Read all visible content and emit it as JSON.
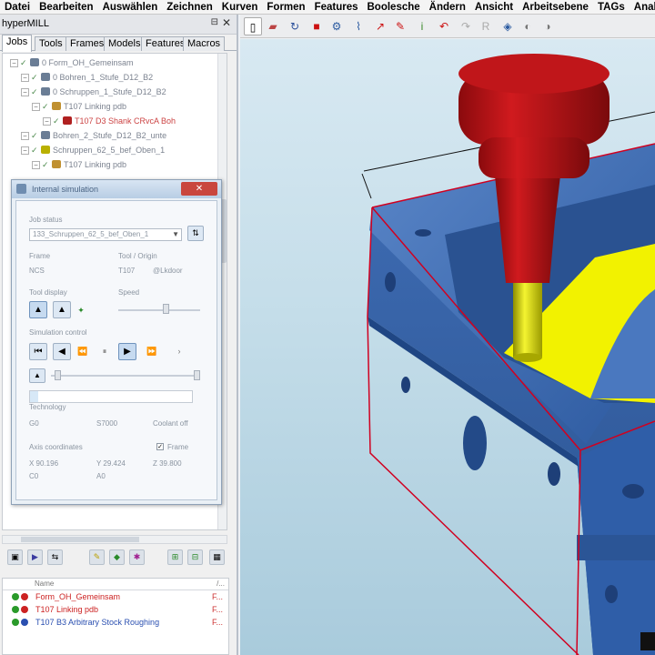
{
  "menubar": [
    "Datei",
    "Bearbeiten",
    "Auswählen",
    "Zeichnen",
    "Kurven",
    "Formen",
    "Features",
    "Boolesche",
    "Ändern",
    "Ansicht",
    "Arbeitsebene",
    "TAGs",
    "Analy"
  ],
  "panel": {
    "title": "hyperMILL",
    "pin": "⊟",
    "close": "✕",
    "tabs": [
      "Jobs",
      "Tools",
      "Frames",
      "Models",
      "Features",
      "Macros"
    ]
  },
  "tree": [
    {
      "label": "0 Form_OH_Gemeinsam",
      "red": false
    },
    {
      "label": "0 Bohren_1_Stufe_D12_B2",
      "red": false
    },
    {
      "label": "0 Schruppen_1_Stufe_D12_B2",
      "red": false
    },
    {
      "label": "T107 Linking pdb",
      "red": false
    },
    {
      "label": "T107 D3 Shank CRvcA Boh",
      "red": true
    },
    {
      "label": "Bohren_2_Stufe_D12_B2_unte",
      "red": false
    },
    {
      "label": "Schruppen_62_5_bef_Oben_1",
      "red": false
    },
    {
      "label": "T107 Linking pdb",
      "red": false
    }
  ],
  "dialog": {
    "title": "Internal simulation",
    "close": "✕",
    "job_status_label": "Job status",
    "job_status_value": "133_Schruppen_62_5_bef_Oben_1",
    "frame_label": "Frame",
    "frame_value": "NCS",
    "tool_origin_label": "Tool / Origin",
    "tool_origin_value": "T107",
    "tool_origin_value2": "@Lkdoor",
    "tool_display_label": "Tool display",
    "speed_label": "Speed",
    "simulation_control_label": "Simulation control",
    "technology_label": "Technology",
    "tech_values": [
      "G0",
      "S7000",
      "Coolant off"
    ],
    "axis_label": "Axis coordinates",
    "frame_check_label": "Frame",
    "coords": [
      "X 90.196",
      "Y 29.424",
      "Z 39.800",
      "C0",
      "A0"
    ],
    "progress": 0.05
  },
  "list": {
    "header_name": "Name",
    "header_end": "/...",
    "rows": [
      {
        "label": "Form_OH_Gemeinsam",
        "color": "#c22",
        "end": "F..."
      },
      {
        "label": "T107 Linking pdb",
        "color": "#c22",
        "end": "F..."
      },
      {
        "label": "T107 B3 Arbitrary Stock Roughing",
        "color": "#2a4fb0",
        "end": "F..."
      }
    ]
  },
  "toolbar_icons": [
    "new-icon",
    "open-icon",
    "save-icon",
    "print-icon",
    "settings-icon",
    "cut-icon",
    "measure-icon",
    "edit-icon",
    "info-icon",
    "undo-icon",
    "redo-icon",
    "rebuild-icon",
    "cube-icon",
    "hide-icon",
    "pick-icon"
  ],
  "colors": {
    "tool_holder": "#b80f12",
    "tool_shank": "#d4d400",
    "part": "#3a68b2",
    "stock": "#d00020",
    "floor": "#f2f200"
  }
}
